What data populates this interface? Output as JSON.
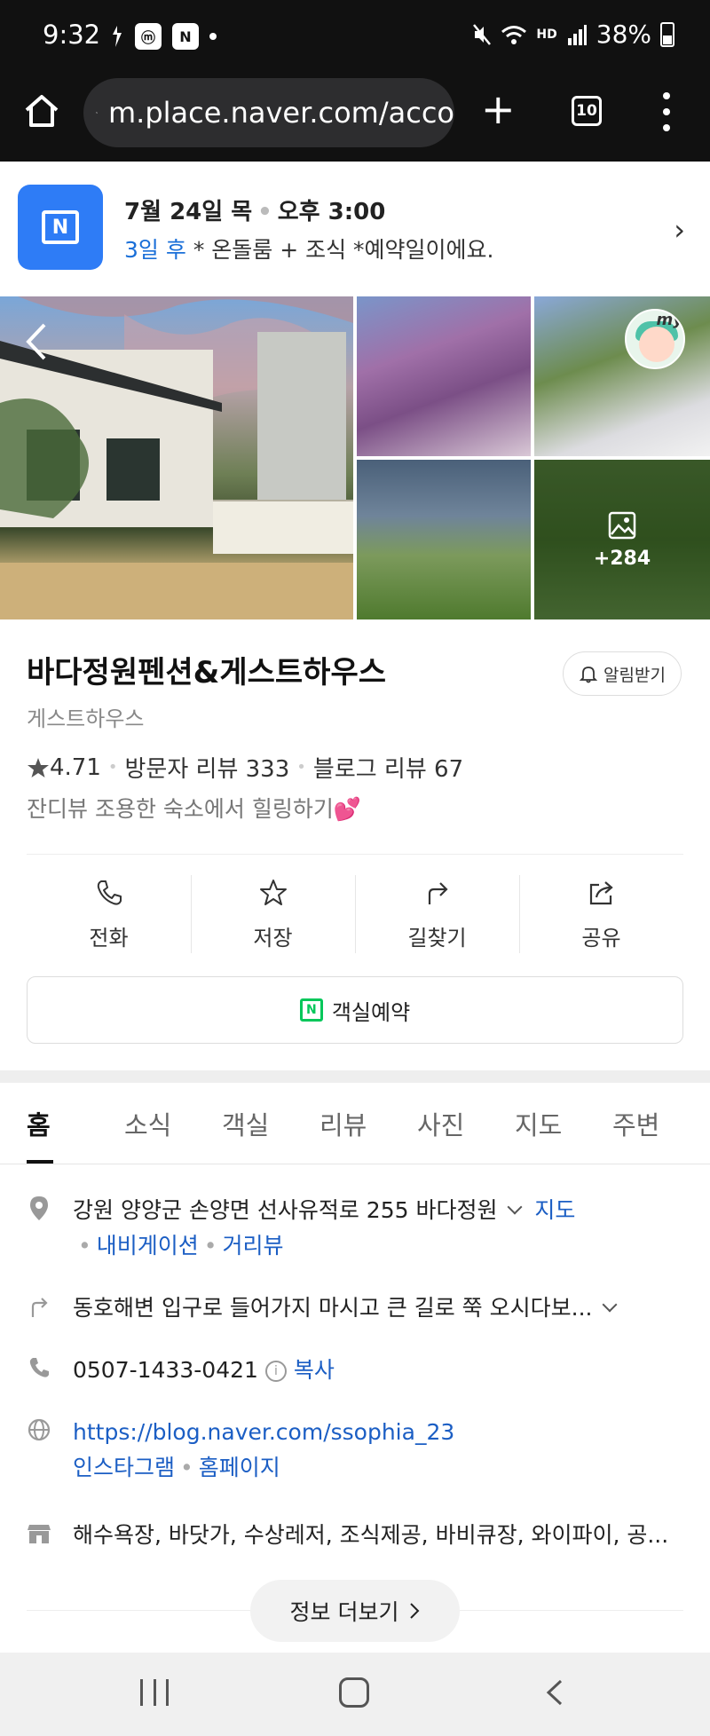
{
  "status_bar": {
    "time": "9:32",
    "battery": "38%",
    "network": "HD",
    "mini_icons": [
      "ⓜ",
      "N"
    ]
  },
  "browser": {
    "url": "m.place.naver.com/acco",
    "tab_count": "10"
  },
  "booking": {
    "date": "7월 24일 목",
    "time": "오후 3:00",
    "when": "3일 후",
    "desc": "* 온돌룸 + 조식 *예약일이에요.",
    "icon_letter": "N"
  },
  "gallery": {
    "more_count": "+284",
    "badge": "my"
  },
  "place": {
    "name": "바다정원펜션&게스트하우스",
    "notify_label": "알림받기",
    "category": "게스트하우스",
    "rating": "4.71",
    "visitor_reviews": "방문자 리뷰 333",
    "blog_reviews": "블로그 리뷰 67",
    "tagline": "잔디뷰 조용한 숙소에서 힐링하기💕"
  },
  "actions": [
    {
      "label": "전화",
      "icon": "phone-icon"
    },
    {
      "label": "저장",
      "icon": "star-icon"
    },
    {
      "label": "길찾기",
      "icon": "directions-icon"
    },
    {
      "label": "공유",
      "icon": "share-icon"
    }
  ],
  "reserve_button": "객실예약",
  "tabs": [
    "홈",
    "소식",
    "객실",
    "리뷰",
    "사진",
    "지도",
    "주변"
  ],
  "info": {
    "address": "강원 양양군 손양면 선사유적로 255 바다정원",
    "map_link": "지도",
    "navi_link": "내비게이션",
    "street_view_link": "거리뷰",
    "directions_text": "동호해변 입구로 들어가지 마시고 큰 길로 쭉 오시다보...",
    "phone": "0507-1433-0421",
    "copy_link": "복사",
    "blog_url": "https://blog.naver.com/ssophia_23",
    "instagram_link": "인스타그램",
    "homepage_link": "홈페이지",
    "amenities": "해수욕장, 바닷가, 수상레저, 조식제공, 바비큐장, 와이파이, 공..."
  },
  "more_info_button": "정보 더보기",
  "colors": {
    "accent_blue": "#2e7cf6",
    "link_blue": "#1b5ec4",
    "naver_green": "#03c75a"
  }
}
